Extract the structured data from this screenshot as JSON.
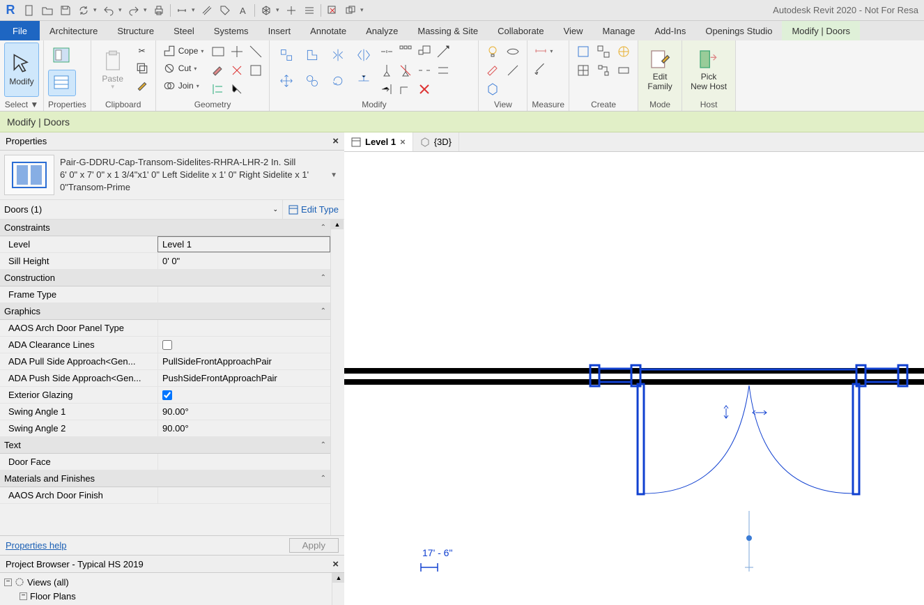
{
  "app": {
    "title": "Autodesk Revit 2020 - Not For Resa"
  },
  "qat": [
    "page-icon",
    "open-icon",
    "save-icon",
    "sync-icon",
    "undo-icon",
    "redo-icon",
    "print-icon",
    "measure-icon",
    "dim-icon",
    "section-icon",
    "text-icon",
    "3d-icon",
    "section2-icon",
    "thin-lines-icon",
    "close-hidden-icon",
    "switch-window-icon"
  ],
  "ribbon": {
    "tabs": [
      "File",
      "Architecture",
      "Structure",
      "Steel",
      "Systems",
      "Insert",
      "Annotate",
      "Analyze",
      "Massing & Site",
      "Collaborate",
      "View",
      "Manage",
      "Add-Ins",
      "Openings Studio",
      "Modify | Doors"
    ],
    "active_tab": "Modify | Doors",
    "panels": {
      "select": {
        "label": "Select ▼",
        "modify": "Modify",
        "properties": "Properties"
      },
      "clipboard": {
        "label": "Clipboard",
        "paste": "Paste"
      },
      "geometry": {
        "label": "Geometry",
        "cope": "Cope",
        "cut": "Cut",
        "join": "Join"
      },
      "modify": {
        "label": "Modify"
      },
      "view": {
        "label": "View"
      },
      "measure": {
        "label": "Measure"
      },
      "create": {
        "label": "Create"
      },
      "mode": {
        "label": "Mode",
        "edit_family": "Edit\nFamily"
      },
      "host": {
        "label": "Host",
        "pick_host": "Pick\nNew Host"
      }
    }
  },
  "options_bar": {
    "text": "Modify | Doors"
  },
  "properties": {
    "title": "Properties",
    "type_name": "Pair-G-DDRU-Cap-Transom-Sidelites-RHRA-LHR-2 In. Sill",
    "type_size": "6' 0\" x 7' 0\" x 1 3/4\"x1' 0\" Left Sidelite x 1' 0\" Right Sidelite x 1' 0\"Transom-Prime",
    "instance_label": "Doors (1)",
    "edit_type": "Edit Type",
    "groups": [
      {
        "name": "Constraints",
        "rows": [
          {
            "n": "Level",
            "v": "Level 1",
            "input": true
          },
          {
            "n": "Sill Height",
            "v": "0'  0\""
          }
        ]
      },
      {
        "name": "Construction",
        "rows": [
          {
            "n": "Frame Type",
            "v": ""
          }
        ]
      },
      {
        "name": "Graphics",
        "rows": [
          {
            "n": "AAOS Arch Door Panel Type",
            "v": ""
          },
          {
            "n": "ADA Clearance Lines",
            "v": "",
            "check": false
          },
          {
            "n": "ADA Pull Side Approach<Gen...",
            "v": "PullSideFrontApproachPair"
          },
          {
            "n": "ADA Push Side Approach<Gen...",
            "v": "PushSideFrontApproachPair"
          },
          {
            "n": "Exterior Glazing",
            "v": "",
            "check": true
          },
          {
            "n": "Swing Angle 1",
            "v": "90.00°"
          },
          {
            "n": "Swing Angle 2",
            "v": "90.00°"
          }
        ]
      },
      {
        "name": "Text",
        "rows": [
          {
            "n": "Door Face",
            "v": ""
          }
        ]
      },
      {
        "name": "Materials and Finishes",
        "rows": [
          {
            "n": "AAOS Arch Door Finish",
            "v": ""
          }
        ]
      }
    ],
    "help_link": "Properties help",
    "apply": "Apply"
  },
  "project_browser": {
    "title": "Project Browser - Typical HS 2019",
    "tree": {
      "root": "Views (all)",
      "child": "Floor Plans"
    }
  },
  "view_tabs": [
    {
      "label": "Level 1",
      "active": true
    },
    {
      "label": "{3D}",
      "active": false
    }
  ],
  "canvas": {
    "dimension_text": "17' - 6\""
  }
}
